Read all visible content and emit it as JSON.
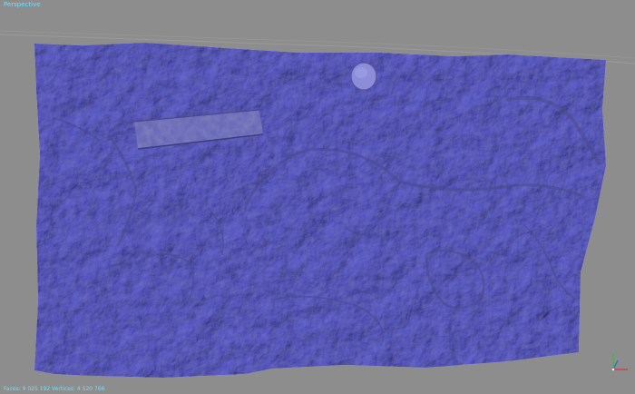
{
  "viewport": {
    "label": "Perspective",
    "status": "Faces: 9 025 192 Vertices: 4 520 766"
  },
  "colors": {
    "background": "#8d8d8d",
    "mesh": "#8a8ad6",
    "mesh_shadow": "#4f4f8e",
    "overlay_text": "#6ee0ff",
    "axis_x": "#e03030",
    "axis_y": "#30c030",
    "axis_z": "#3060e0"
  },
  "icons": {
    "axis_gizmo": "xyz-axis-gizmo-icon"
  }
}
